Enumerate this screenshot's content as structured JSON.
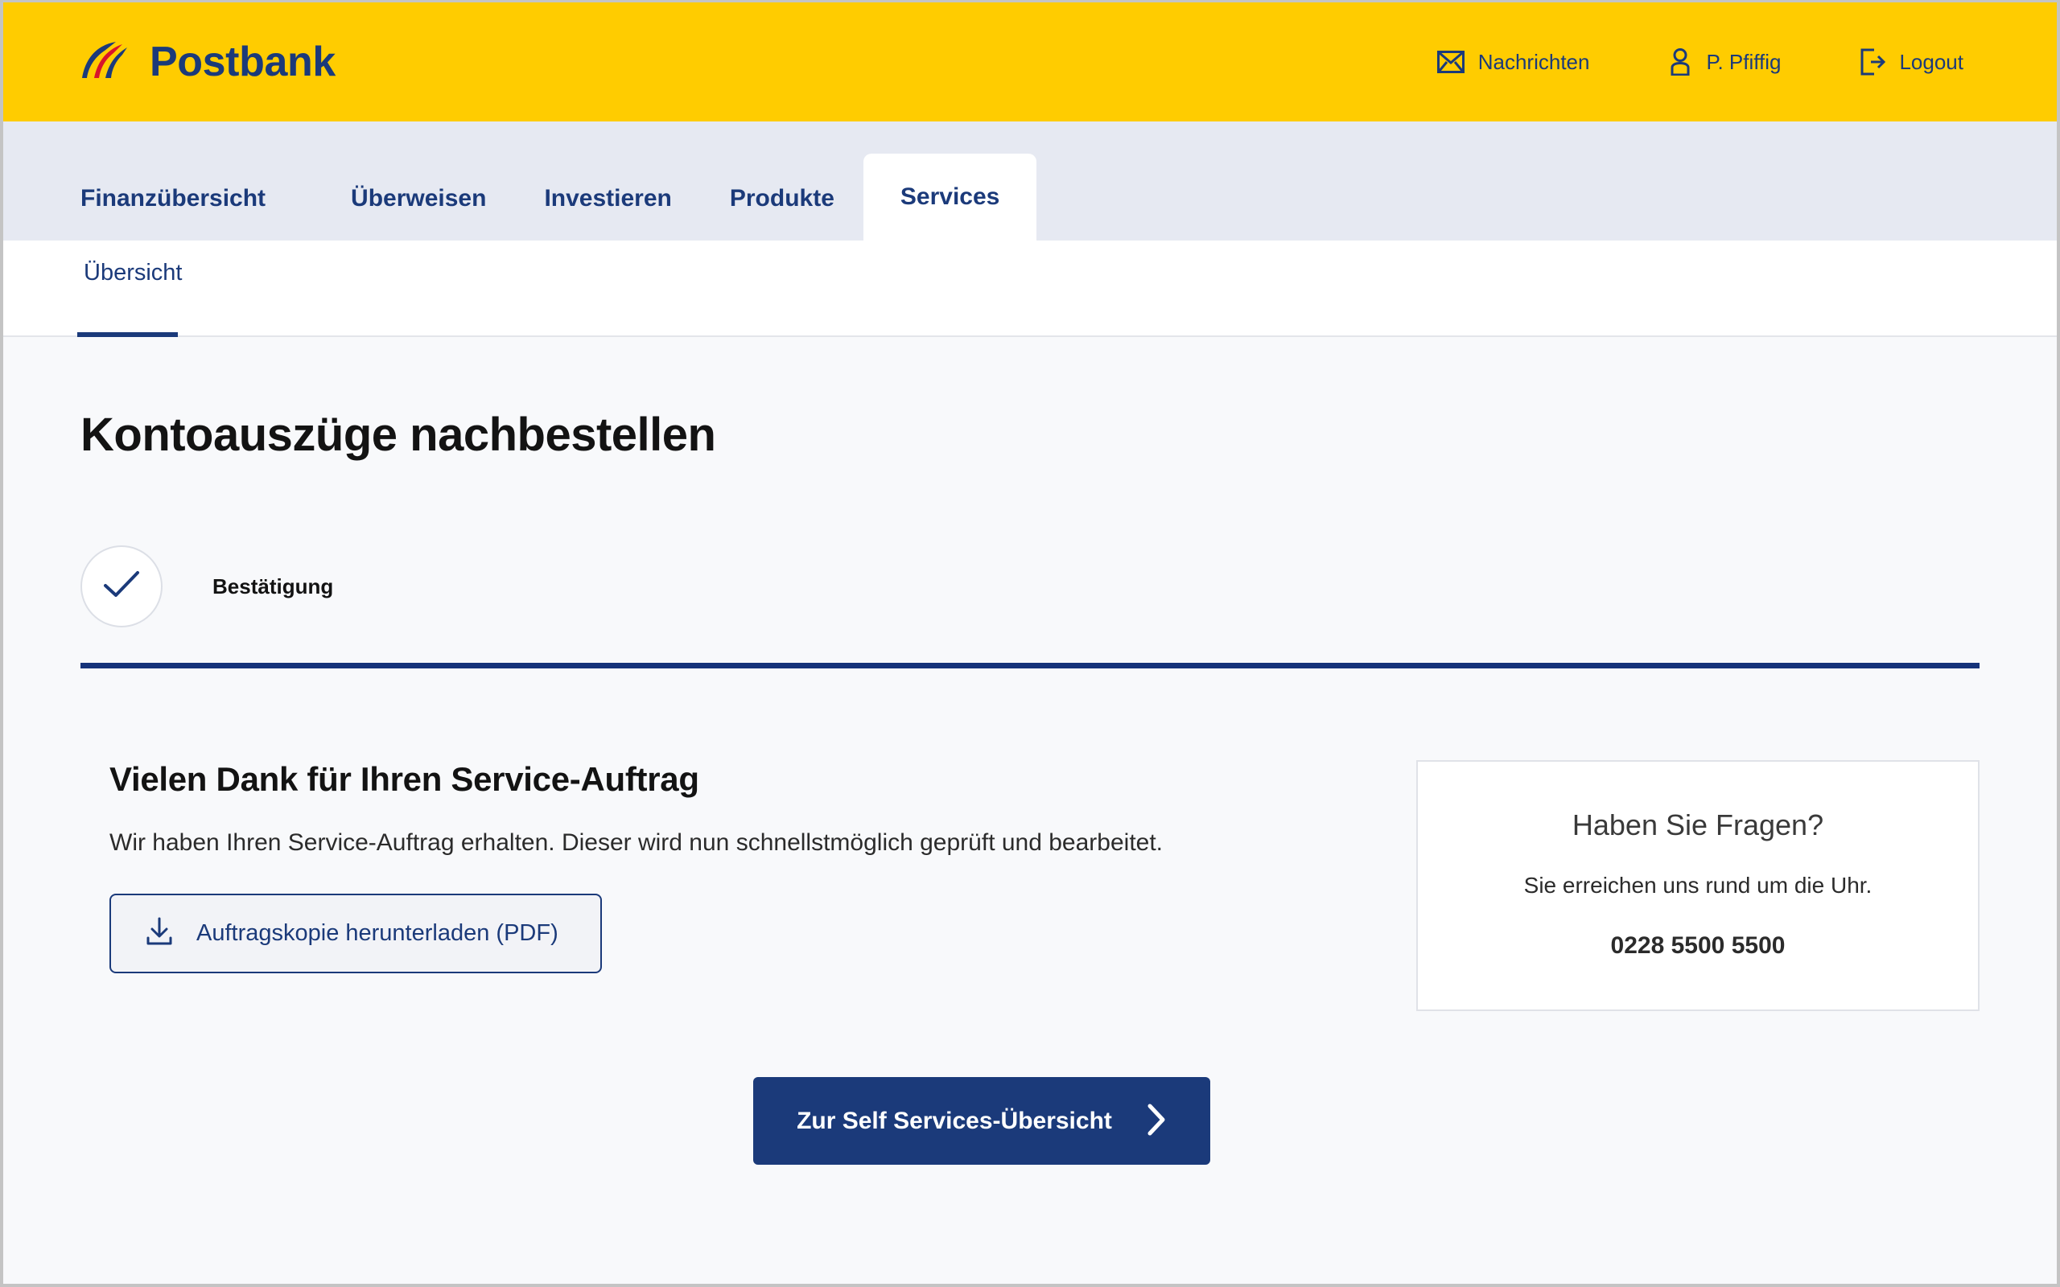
{
  "brand": {
    "name": "Postbank",
    "logo_icon": "postbank-swoosh-logo",
    "header_bg": "#FFCC00",
    "navy": "#1B3A7A"
  },
  "header": {
    "actions": [
      {
        "label": "Nachrichten",
        "icon": "envelope-icon"
      },
      {
        "label": "P. Pfiffig",
        "icon": "person-icon"
      },
      {
        "label": "Logout",
        "icon": "logout-icon"
      }
    ]
  },
  "main_nav": {
    "tabs": [
      {
        "label": "Finanzübersicht",
        "active": false
      },
      {
        "label": "Überweisen",
        "active": false
      },
      {
        "label": "Investieren",
        "active": false
      },
      {
        "label": "Produkte",
        "active": false
      },
      {
        "label": "Services",
        "active": true
      }
    ]
  },
  "sub_nav": {
    "tabs": [
      {
        "label": "Übersicht",
        "active": true
      }
    ]
  },
  "page": {
    "title": "Kontoauszüge nachbestellen"
  },
  "stepper": {
    "steps": [
      {
        "label": "Bestätigung",
        "state": "completed",
        "icon": "check-icon"
      }
    ],
    "rule_color": "#16337A"
  },
  "main": {
    "heading": "Vielen Dank für Ihren Service-Auftrag",
    "text": "Wir haben Ihren Service-Auftrag erhalten. Dieser wird nun schnellstmöglich geprüft und bearbeitet.",
    "download_button": {
      "label": "Auftragskopie herunterladen (PDF)",
      "icon": "download-icon"
    }
  },
  "info_card": {
    "title": "Haben Sie Fragen?",
    "subtitle": "Sie erreichen uns rund um die Uhr.",
    "phone": "0228 5500 5500"
  },
  "cta": {
    "label": "Zur Self Services-Übersicht",
    "icon": "chevron-right-icon"
  }
}
